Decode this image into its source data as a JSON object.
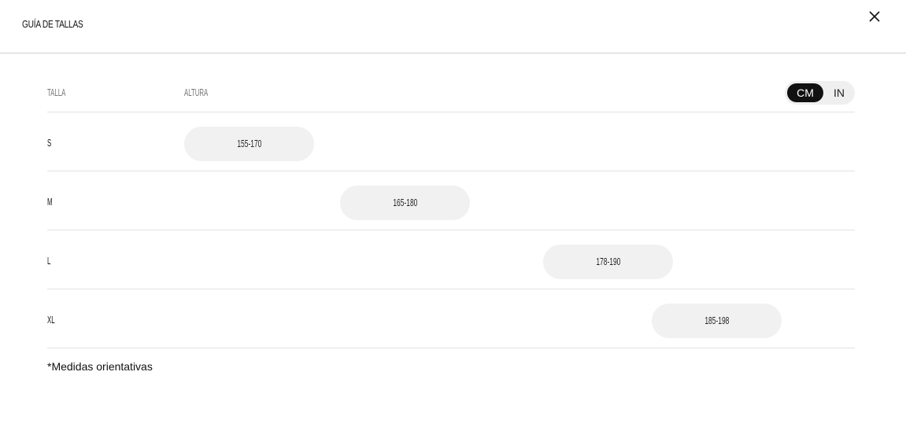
{
  "header": {
    "title": "GUÍA DE TALLAS"
  },
  "table": {
    "columns": {
      "size": "TALLA",
      "height": "ALTURA"
    },
    "unit_toggle": {
      "options": [
        "CM",
        "IN"
      ],
      "selected": "CM"
    },
    "rows": [
      {
        "size": "S",
        "range": "155-170"
      },
      {
        "size": "M",
        "range": "165-180"
      },
      {
        "size": "L",
        "range": "178-190"
      },
      {
        "size": "XL",
        "range": "185-198"
      }
    ]
  },
  "footnote": "*Medidas orientativas",
  "colors": {
    "toggle_active_bg": "#111111",
    "pill_bg": "#f1f1f1",
    "divider": "#e2e2e2"
  },
  "icons": {
    "close": "close-icon"
  }
}
